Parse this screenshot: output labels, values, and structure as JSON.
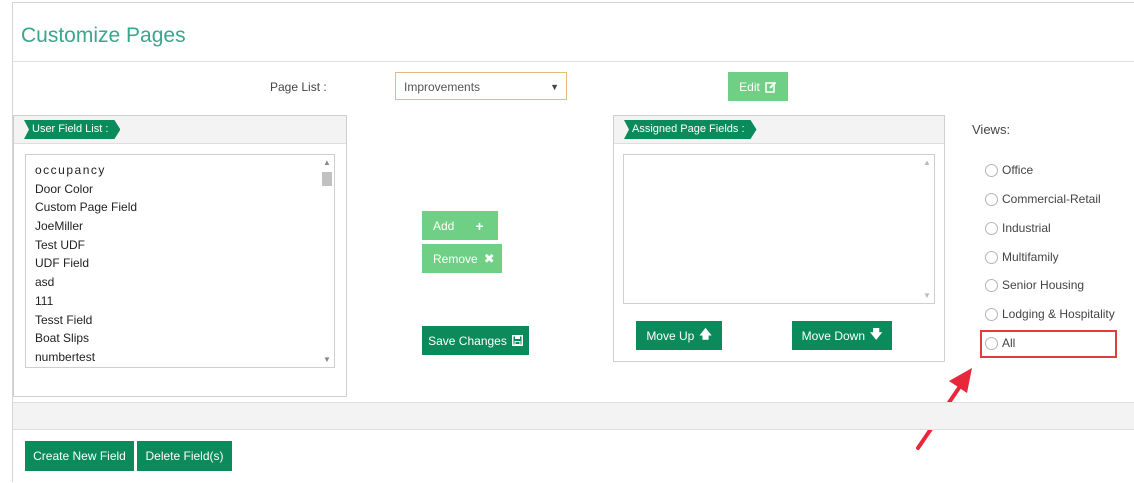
{
  "page": {
    "title": "Customize Pages"
  },
  "page_list": {
    "label": "Page List :",
    "selected": "Improvements"
  },
  "buttons": {
    "edit": "Edit",
    "add": "Add",
    "remove": "Remove",
    "save_changes": "Save Changes",
    "move_up": "Move Up",
    "move_down": "Move Down",
    "create_new_field": "Create New Field",
    "delete_fields": "Delete Field(s)"
  },
  "user_field_list": {
    "title": "User Field List :",
    "items": [
      "occupancy",
      "Door Color",
      "Custom Page Field",
      "JoeMiller",
      "Test UDF",
      "UDF Field",
      "asd",
      "111",
      "Tesst Field",
      "Boat Slips",
      "numbertest"
    ]
  },
  "assigned_page_fields": {
    "title": "Assigned Page Fields :",
    "items": []
  },
  "views": {
    "label": "Views:",
    "options": [
      "Office",
      "Commercial-Retail",
      "Industrial",
      "Multifamily",
      "Senior Housing",
      "Lodging & Hospitality",
      "All"
    ]
  },
  "colors": {
    "accent": "#0b8a5c",
    "accent_light": "#6fcf84",
    "title": "#3aa68e",
    "highlight": "#e23d3d"
  },
  "icons": {
    "edit": "edit-square-icon",
    "add": "plus-icon",
    "remove": "x-icon",
    "save": "floppy-disk-icon",
    "move_up": "arrow-up-icon",
    "move_down": "arrow-down-icon"
  }
}
